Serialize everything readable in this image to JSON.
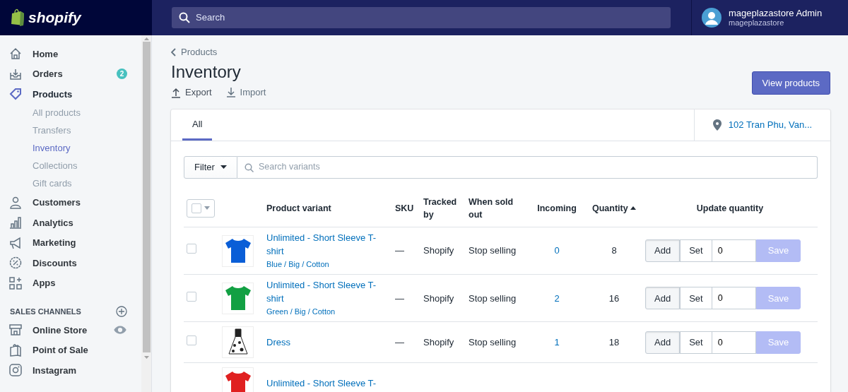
{
  "topbar": {
    "logo": "shopify",
    "search": {
      "placeholder": "Search"
    },
    "user": {
      "name": "mageplazastore Admin",
      "store": "mageplazastore"
    }
  },
  "sidebar": {
    "items": [
      {
        "label": "Home",
        "kind": "home",
        "selected": false
      },
      {
        "label": "Orders",
        "kind": "orders",
        "selected": false,
        "badge": "2"
      },
      {
        "label": "Products",
        "kind": "products",
        "selected": true,
        "children": [
          {
            "label": "All products",
            "selected": false
          },
          {
            "label": "Transfers",
            "selected": false
          },
          {
            "label": "Inventory",
            "selected": true
          },
          {
            "label": "Collections",
            "selected": false
          },
          {
            "label": "Gift cards",
            "selected": false
          }
        ]
      },
      {
        "label": "Customers",
        "kind": "customers",
        "selected": false
      },
      {
        "label": "Analytics",
        "kind": "analytics",
        "selected": false
      },
      {
        "label": "Marketing",
        "kind": "marketing",
        "selected": false
      },
      {
        "label": "Discounts",
        "kind": "discounts",
        "selected": false
      },
      {
        "label": "Apps",
        "kind": "apps",
        "selected": false
      }
    ],
    "section": "SALES CHANNELS",
    "channels": [
      {
        "label": "Online Store",
        "kind": "store",
        "previewable": true
      },
      {
        "label": "Point of Sale",
        "kind": "pos",
        "previewable": false
      },
      {
        "label": "Instagram",
        "kind": "instagram",
        "previewable": false
      }
    ]
  },
  "breadcrumb": "Products",
  "title": "Inventory",
  "actions": [
    {
      "label": "Export",
      "kind": "export"
    },
    {
      "label": "Import",
      "kind": "import"
    }
  ],
  "primary_button": "View products",
  "tabs": [
    {
      "label": "All",
      "selected": true
    }
  ],
  "location": "102 Tran Phu, Van...",
  "filter": {
    "label": "Filter",
    "placeholder": "Search variants"
  },
  "table": {
    "select_all_checked": false,
    "columns": [
      {
        "label": "Product variant"
      },
      {
        "label": "SKU"
      },
      {
        "label": "Tracked by"
      },
      {
        "label": "When sold out"
      },
      {
        "label": "Incoming"
      },
      {
        "label": "Quantity",
        "sorted": true
      },
      {
        "label": "Update quantity"
      }
    ],
    "rows": [
      {
        "name": "Unlimited - Short Sleeve T-shirt",
        "variant": "Blue / Big / Cotton",
        "kind": "tshirt",
        "color": "#0a5ed7",
        "checked": false,
        "sku": "—",
        "tracked": "Shopify",
        "sold_out": "Stop selling",
        "incoming": "0",
        "quantity": "8",
        "buttons": [
          {
            "label": "Add",
            "selected": true
          },
          {
            "label": "Set",
            "selected": false
          }
        ],
        "value": "0",
        "save": "Save"
      },
      {
        "name": "Unlimited - Short Sleeve T-shirt",
        "variant": "Green / Big / Cotton",
        "kind": "tshirt",
        "color": "#12a043",
        "checked": false,
        "sku": "—",
        "tracked": "Shopify",
        "sold_out": "Stop selling",
        "incoming": "2",
        "quantity": "16",
        "buttons": [
          {
            "label": "Add",
            "selected": true
          },
          {
            "label": "Set",
            "selected": false
          }
        ],
        "value": "0",
        "save": "Save"
      },
      {
        "name": "Dress",
        "kind": "dress",
        "color": "#222222",
        "checked": false,
        "sku": "—",
        "tracked": "Shopify",
        "sold_out": "Stop selling",
        "incoming": "1",
        "quantity": "18",
        "buttons": [
          {
            "label": "Add",
            "selected": true
          },
          {
            "label": "Set",
            "selected": false
          }
        ],
        "value": "0",
        "save": "Save"
      },
      {
        "name": "Unlimited - Short Sleeve T-",
        "kind": "tshirt",
        "color": "#e02020"
      }
    ]
  }
}
